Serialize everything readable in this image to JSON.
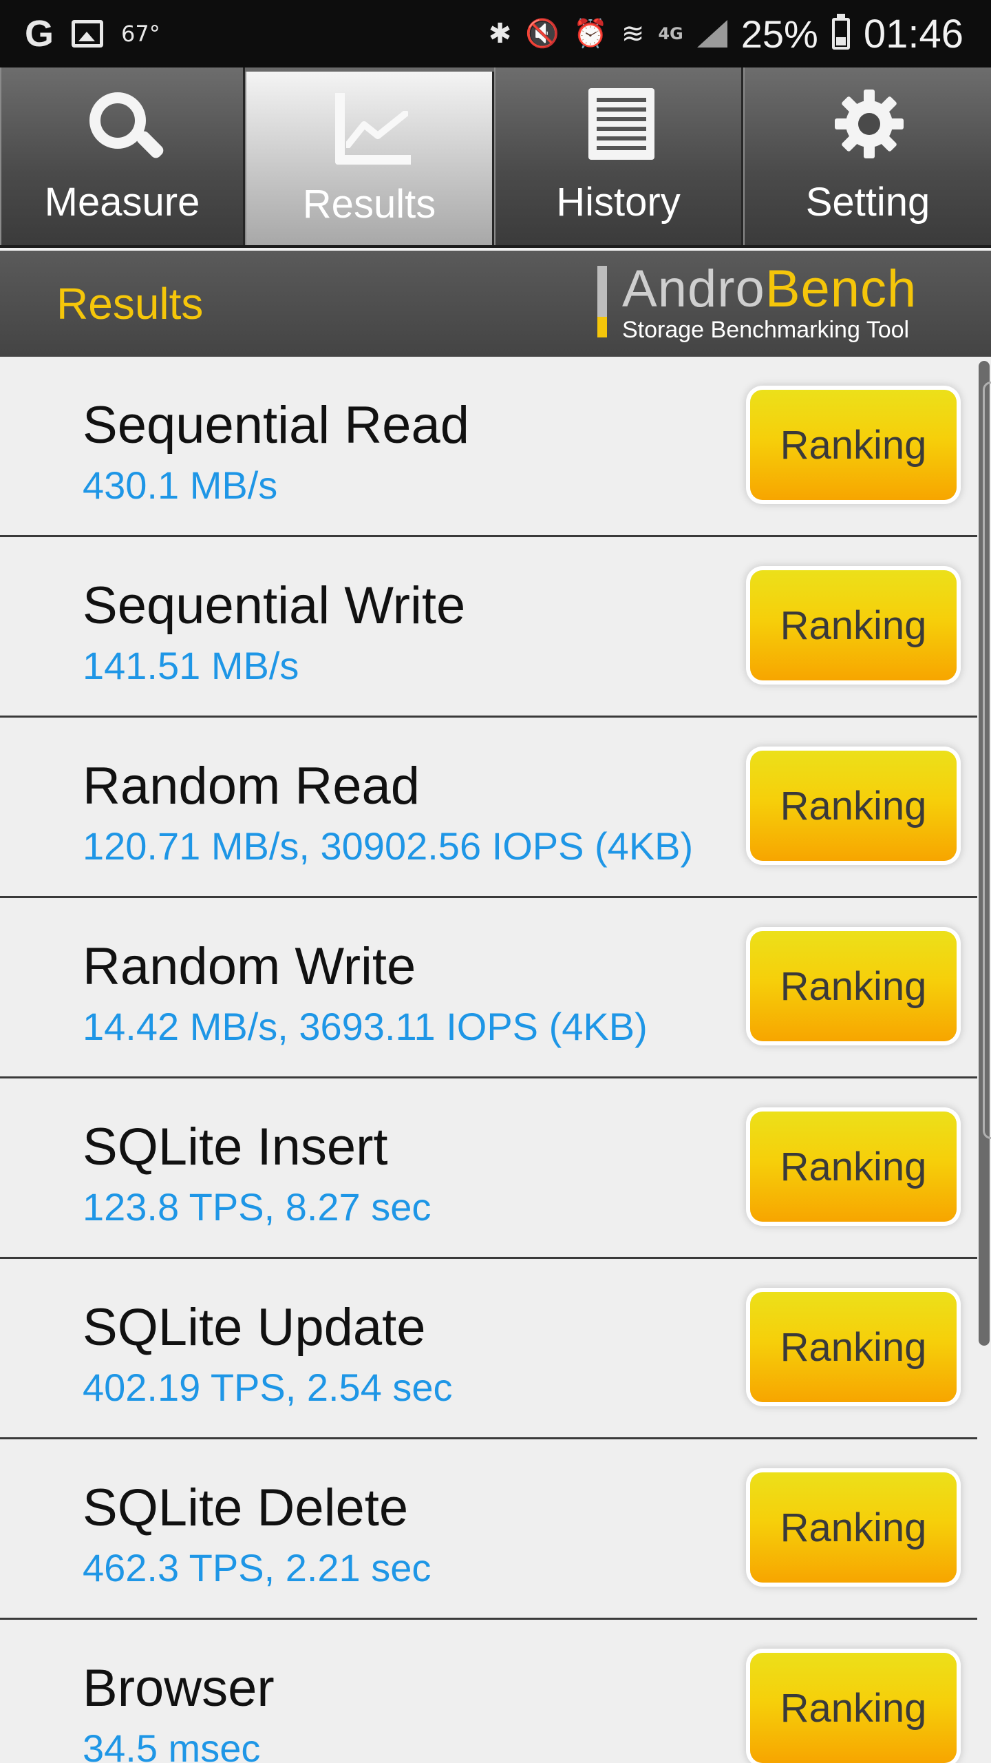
{
  "status_bar": {
    "g_icon": "G",
    "temperature": "67°",
    "network_type": "4G",
    "battery_percent": "25%",
    "time": "01:46",
    "icons": [
      "google-icon",
      "image-icon",
      "bluetooth-icon",
      "mute-icon",
      "alarm-icon",
      "wifi-icon",
      "signal-icon",
      "battery-icon"
    ]
  },
  "tabs": [
    {
      "label": "Measure",
      "icon": "magnifier-icon",
      "active": false
    },
    {
      "label": "Results",
      "icon": "chart-icon",
      "active": true
    },
    {
      "label": "History",
      "icon": "document-icon",
      "active": false
    },
    {
      "label": "Setting",
      "icon": "gear-icon",
      "active": false
    }
  ],
  "header": {
    "title": "Results",
    "logo_andro": "Andro",
    "logo_bench": "Bench",
    "logo_tagline": "Storage Benchmarking Tool"
  },
  "colors": {
    "accent_yellow": "#f5c60a",
    "value_blue": "#1e96e6",
    "button_gradient_top": "#ece01a",
    "button_gradient_bottom": "#f7a500"
  },
  "results": [
    {
      "title": "Sequential Read",
      "value": "430.1 MB/s",
      "button": "Ranking"
    },
    {
      "title": "Sequential Write",
      "value": "141.51 MB/s",
      "button": "Ranking"
    },
    {
      "title": "Random Read",
      "value": "120.71 MB/s, 30902.56 IOPS (4KB)",
      "button": "Ranking"
    },
    {
      "title": "Random Write",
      "value": "14.42 MB/s, 3693.11 IOPS (4KB)",
      "button": "Ranking"
    },
    {
      "title": "SQLite Insert",
      "value": "123.8 TPS, 8.27 sec",
      "button": "Ranking"
    },
    {
      "title": "SQLite Update",
      "value": "402.19 TPS, 2.54 sec",
      "button": "Ranking"
    },
    {
      "title": "SQLite Delete",
      "value": "462.3 TPS, 2.21 sec",
      "button": "Ranking"
    },
    {
      "title": "Browser",
      "value": "34.5 msec",
      "button": "Ranking"
    }
  ]
}
